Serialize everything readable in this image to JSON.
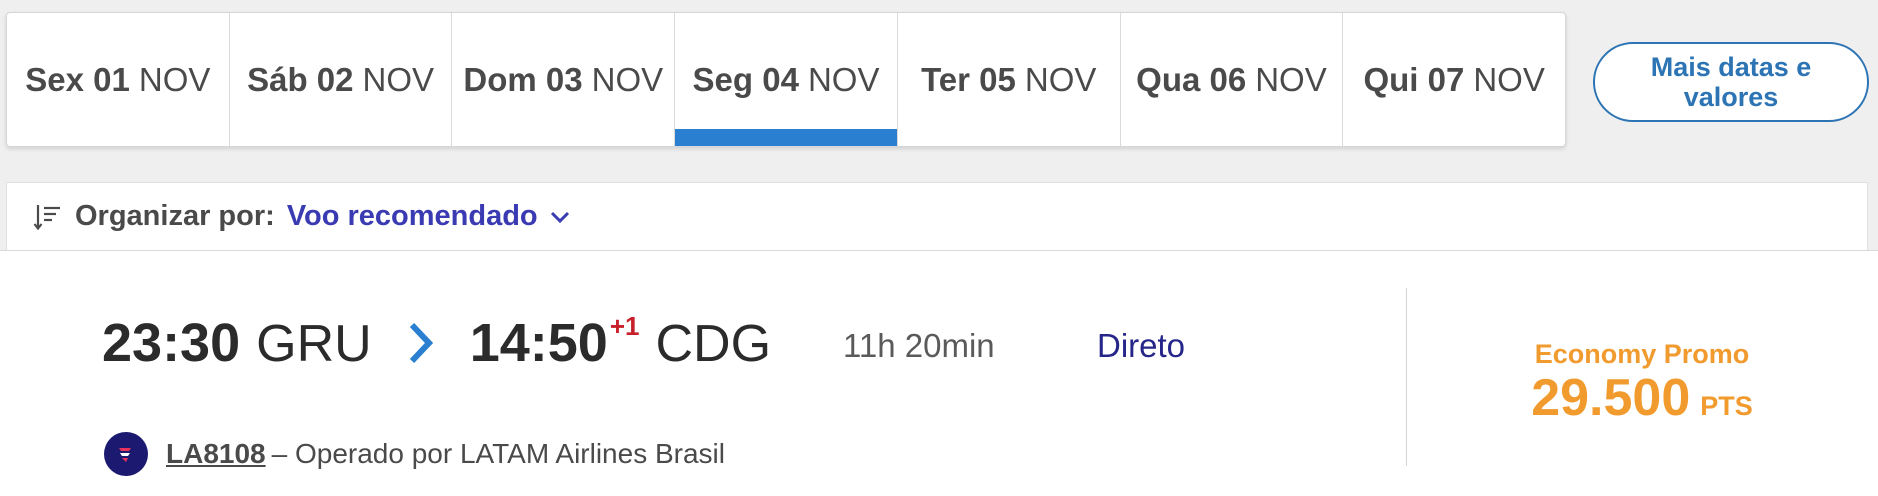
{
  "date_tabs": [
    {
      "day": "Sex 01",
      "month": "NOV",
      "active": false
    },
    {
      "day": "Sáb 02",
      "month": "NOV",
      "active": false
    },
    {
      "day": "Dom 03",
      "month": "NOV",
      "active": false
    },
    {
      "day": "Seg 04",
      "month": "NOV",
      "active": true
    },
    {
      "day": "Ter 05",
      "month": "NOV",
      "active": false
    },
    {
      "day": "Qua 06",
      "month": "NOV",
      "active": false
    },
    {
      "day": "Qui 07",
      "month": "NOV",
      "active": false
    }
  ],
  "more_dates_label": "Mais datas e valores",
  "sort": {
    "icon": "sort-icon",
    "label": "Organizar por:",
    "value": "Voo recomendado"
  },
  "flight": {
    "departure_time": "23:30",
    "origin": "GRU",
    "arrival_time": "14:50",
    "day_offset": "+1",
    "destination": "CDG",
    "duration": "11h 20min",
    "stops": "Direto",
    "flight_number": "LA8108",
    "operated_by": "– Operado por LATAM Airlines Brasil",
    "fare_class": "Economy Promo",
    "price": "29.500",
    "price_unit": "PTS"
  },
  "colors": {
    "active_tab": "#2a7fd0",
    "link_blue": "#2d74b4",
    "sort_value": "#3a3ab3",
    "price": "#f19a2e",
    "day_offset": "#c8202a",
    "airline": "#1c1a70"
  }
}
